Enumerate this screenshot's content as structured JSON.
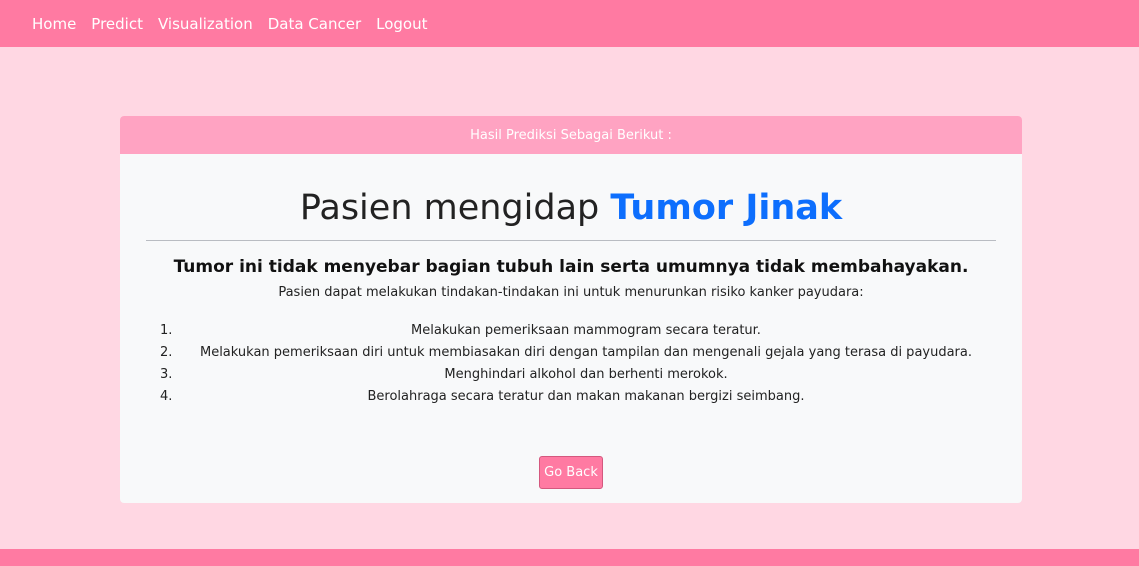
{
  "nav": {
    "items": [
      "Home",
      "Predict",
      "Visualization",
      "Data Cancer",
      "Logout"
    ]
  },
  "card": {
    "header": "Hasil Prediksi Sebagai Berikut :",
    "title_prefix": "Pasien mengidap",
    "title_highlight": "Tumor Jinak",
    "subtitle": "Tumor ini tidak menyebar bagian tubuh lain serta umumnya tidak membahayakan.",
    "intro": "Pasien dapat melakukan tindakan-tindakan ini untuk menurunkan risiko kanker payudara:",
    "tips": [
      {
        "num": "1.",
        "text": "Melakukan pemeriksaan mammogram secara teratur."
      },
      {
        "num": "2.",
        "text": "Melakukan pemeriksaan diri untuk membiasakan diri dengan tampilan dan mengenali gejala yang terasa di payudara."
      },
      {
        "num": "3.",
        "text": "Menghindari alkohol dan berhenti merokok."
      },
      {
        "num": "4.",
        "text": "Berolahraga secara teratur dan makan makanan bergizi seimbang."
      }
    ],
    "button": "Go Back"
  },
  "colors": {
    "navbar": "#ff7aa2",
    "background": "#ffd7e3",
    "card_header": "#ffa3c2",
    "highlight": "#0d6efd"
  }
}
